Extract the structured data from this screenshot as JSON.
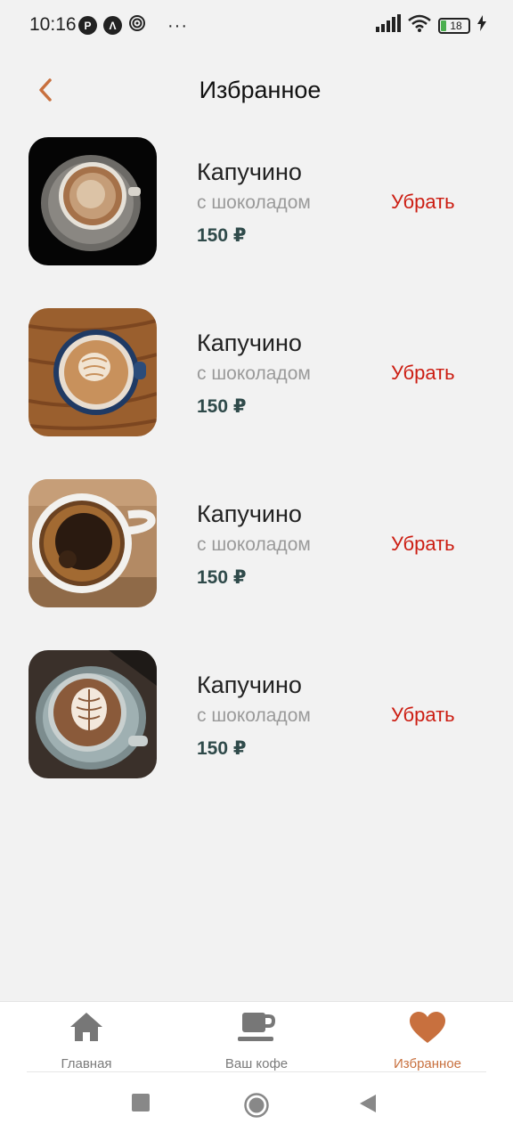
{
  "status_bar": {
    "time": "10:16",
    "icons": [
      "p-icon",
      "a-icon",
      "swirl-icon"
    ],
    "more": "···",
    "battery": "18"
  },
  "header": {
    "title": "Избранное"
  },
  "colors": {
    "accent": "#c8703e",
    "remove": "#cc1d12",
    "price": "#2f4a4a",
    "background": "#f2f2f2"
  },
  "favorites": [
    {
      "name": "Капучино",
      "subtitle": "с шоколадом",
      "price": "150 ₽",
      "remove_label": "Убрать",
      "image": "cappuccino-black-background"
    },
    {
      "name": "Капучино",
      "subtitle": "с шоколадом",
      "price": "150 ₽",
      "remove_label": "Убрать",
      "image": "latte-art-blue-cup"
    },
    {
      "name": "Капучино",
      "subtitle": "с шоколадом",
      "price": "150 ₽",
      "remove_label": "Убрать",
      "image": "black-coffee-white-cup"
    },
    {
      "name": "Капучино",
      "subtitle": "с шоколадом",
      "price": "150 ₽",
      "remove_label": "Убрать",
      "image": "latte-art-grey-cup"
    }
  ],
  "bottom_nav": {
    "items": [
      {
        "label": "Главная",
        "icon": "home-icon",
        "active": false
      },
      {
        "label": "Ваш кофе",
        "icon": "coffee-cup-icon",
        "active": false
      },
      {
        "label": "Избранное",
        "icon": "heart-icon",
        "active": true
      }
    ]
  },
  "system_nav": [
    "recents-square-icon",
    "home-circle-icon",
    "back-triangle-icon"
  ]
}
